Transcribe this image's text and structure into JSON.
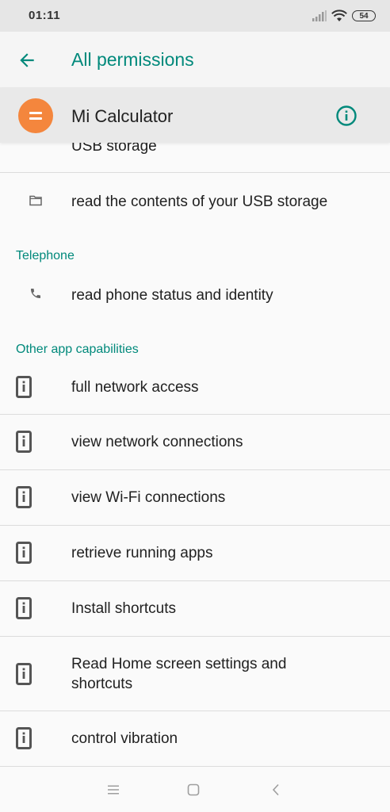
{
  "status_bar": {
    "time": "01:11",
    "battery": "54"
  },
  "app_bar": {
    "title": "All permissions"
  },
  "app_header": {
    "app_name": "Mi Calculator"
  },
  "permissions": {
    "partial_top": "USB storage",
    "storage_read": "read the contents of your USB storage",
    "sections": [
      {
        "title": "Telephone",
        "items": [
          "read phone status and identity"
        ]
      },
      {
        "title": "Other app capabilities",
        "items": [
          "full network access",
          "view network connections",
          "view Wi-Fi connections",
          "retrieve running apps",
          "Install shortcuts",
          "Read Home screen settings and shortcuts",
          "control vibration"
        ]
      }
    ]
  },
  "colors": {
    "accent": "#00897b",
    "app_icon": "#f4863d"
  }
}
